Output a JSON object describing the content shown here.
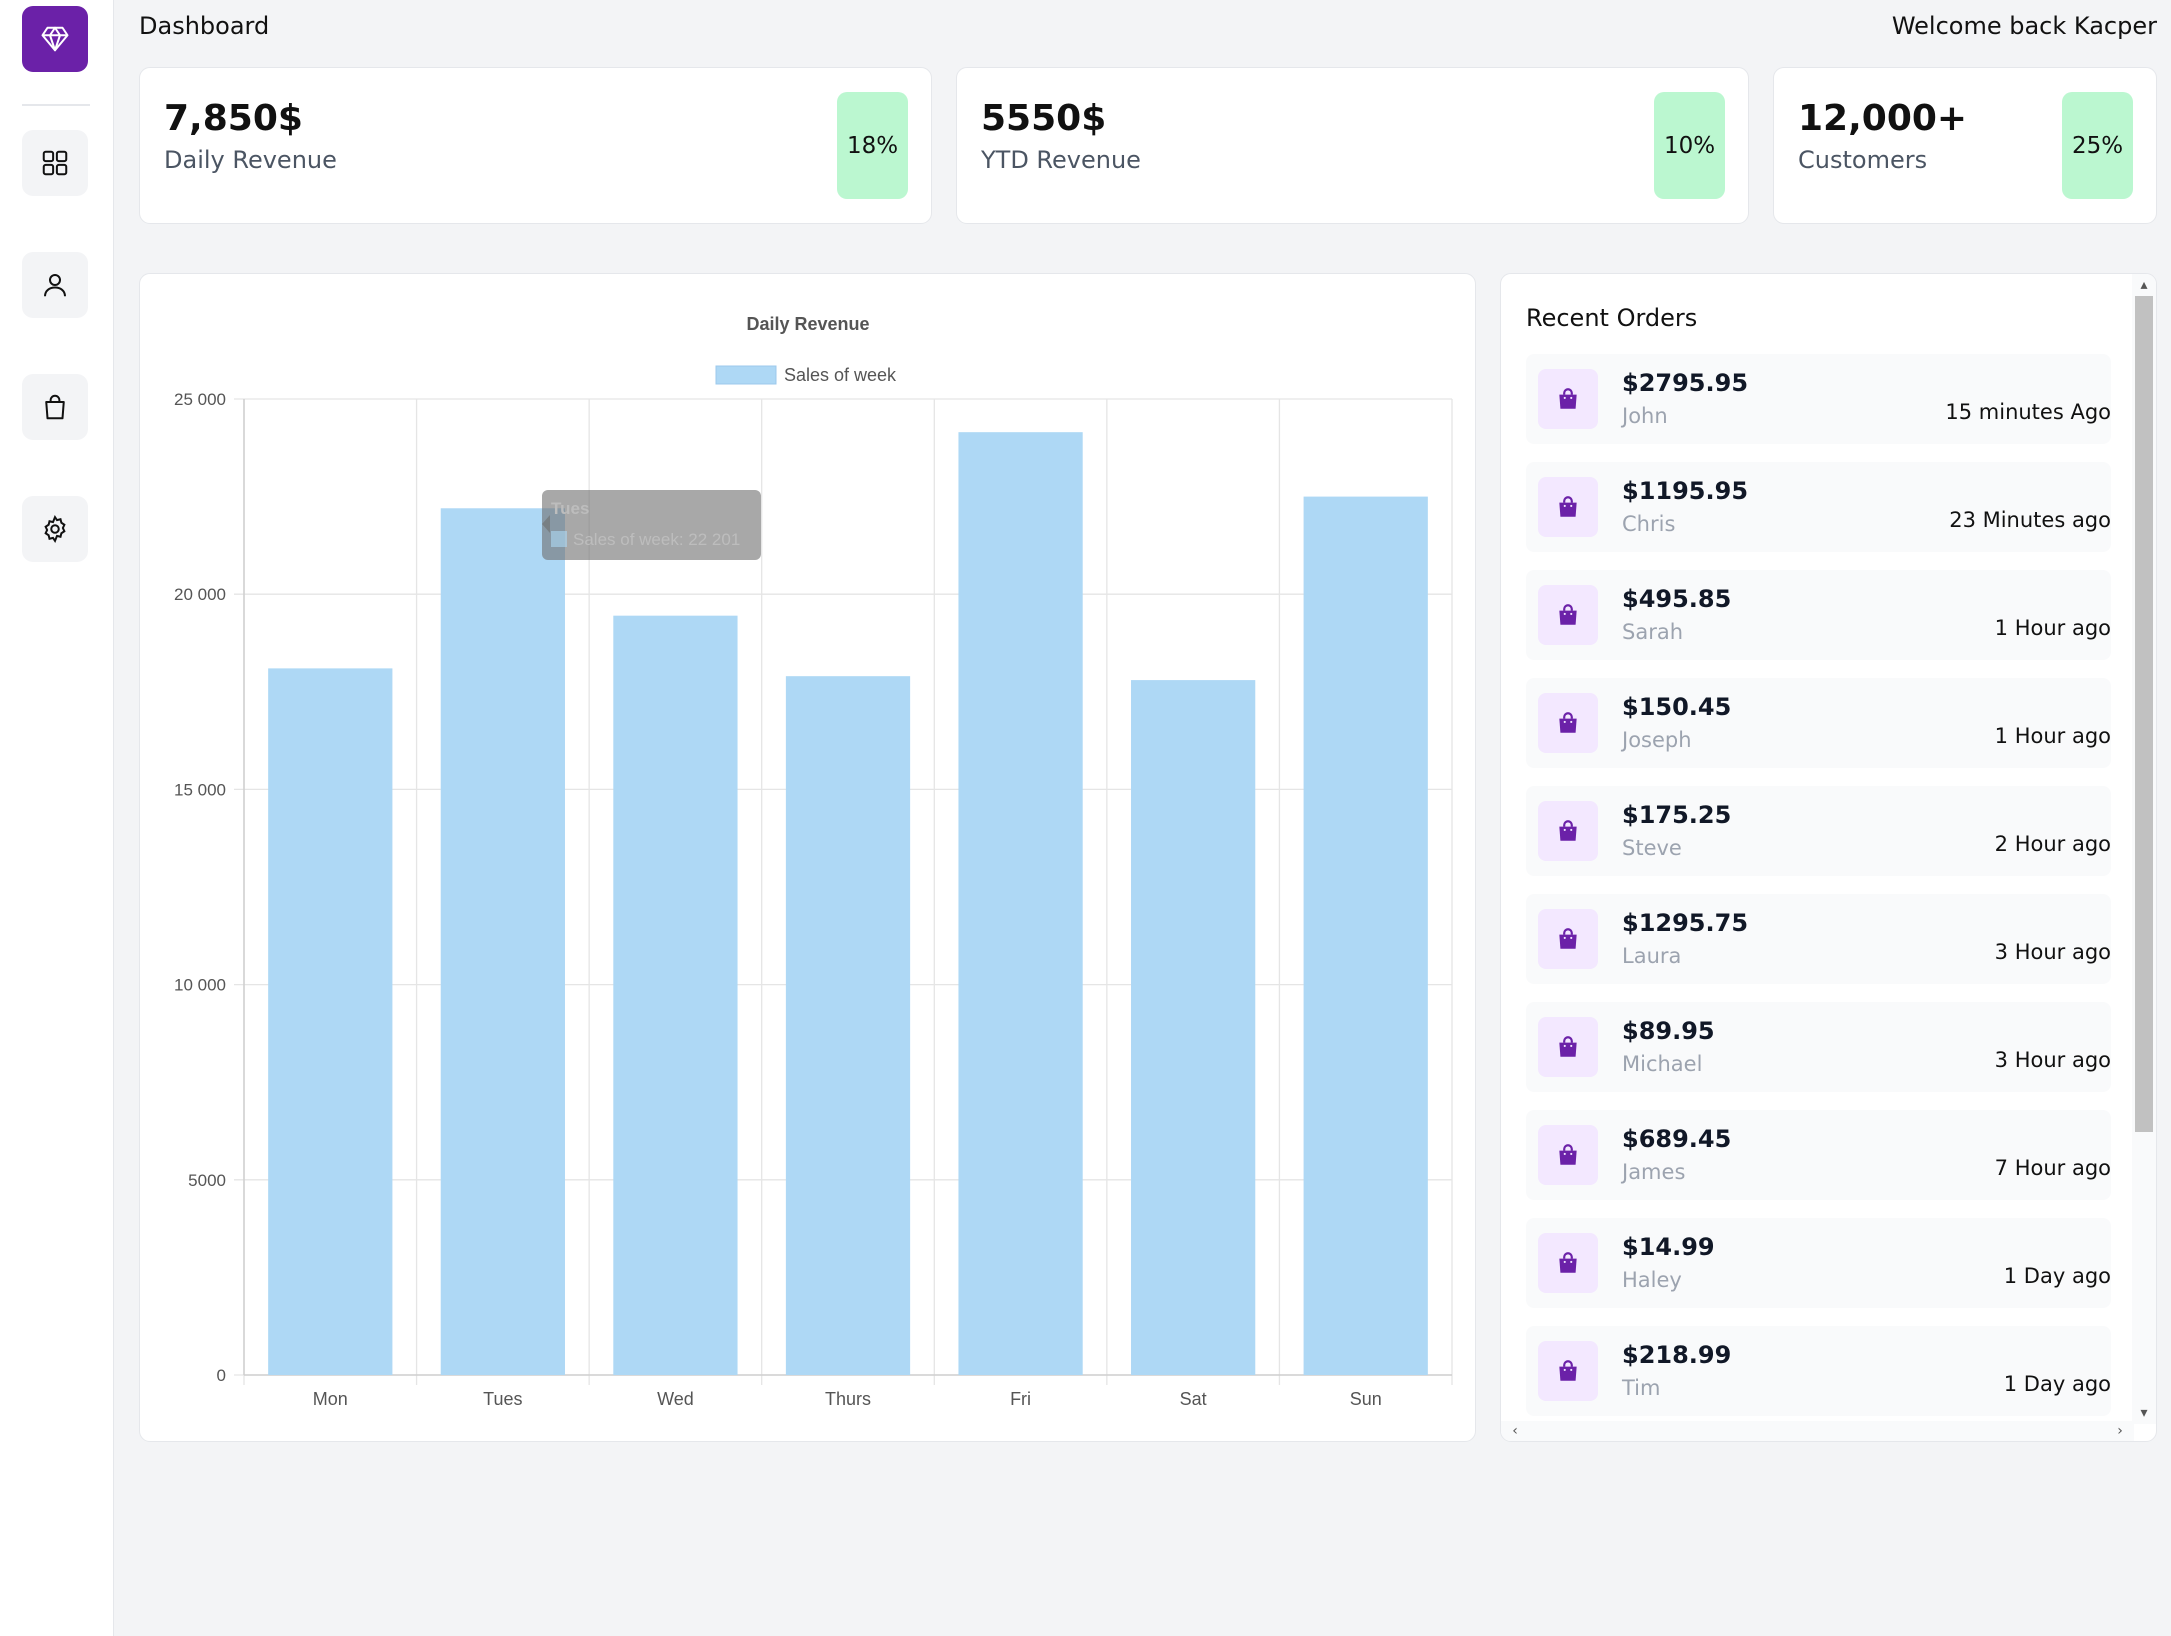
{
  "sidebar": {
    "logo_icon": "diamond-icon",
    "items": [
      {
        "icon": "dashboard-grid-icon"
      },
      {
        "icon": "user-icon"
      },
      {
        "icon": "shopping-bag-icon"
      },
      {
        "icon": "settings-gear-icon"
      }
    ]
  },
  "header": {
    "title": "Dashboard",
    "welcome": "Welcome back Kacper"
  },
  "stats": [
    {
      "value": "7,850$",
      "label": "Daily Revenue",
      "badge": "18%"
    },
    {
      "value": "5550$",
      "label": "YTD Revenue",
      "badge": "10%"
    },
    {
      "value": "12,000+",
      "label": "Customers",
      "badge": "25%"
    }
  ],
  "chart_data": {
    "type": "bar",
    "title": "Daily Revenue",
    "legend": "Sales of week",
    "legend_position": "top",
    "categories": [
      "Mon",
      "Tues",
      "Wed",
      "Thurs",
      "Fri",
      "Sat",
      "Sun"
    ],
    "series": [
      {
        "name": "Sales of week",
        "values": [
          18100,
          22201,
          19450,
          17900,
          24150,
          17800,
          22500
        ]
      }
    ],
    "ylim": [
      0,
      25000
    ],
    "yticks": [
      "0",
      "5000",
      "10 000",
      "15 000",
      "20 000",
      "25 000"
    ],
    "grid": true,
    "bar_color": "#aed8f5",
    "tooltip": {
      "title": "Tues",
      "text": "Sales of week: 22 201"
    }
  },
  "orders": {
    "title": "Recent Orders",
    "items": [
      {
        "amount": "$2795.95",
        "name": "John",
        "time": "15 minutes Ago"
      },
      {
        "amount": "$1195.95",
        "name": "Chris",
        "time": "23 Minutes ago"
      },
      {
        "amount": "$495.85",
        "name": "Sarah",
        "time": "1 Hour ago"
      },
      {
        "amount": "$150.45",
        "name": "Joseph",
        "time": "1 Hour ago"
      },
      {
        "amount": "$175.25",
        "name": "Steve",
        "time": "2 Hour ago"
      },
      {
        "amount": "$1295.75",
        "name": "Laura",
        "time": "3 Hour ago"
      },
      {
        "amount": "$89.95",
        "name": "Michael",
        "time": "3 Hour ago"
      },
      {
        "amount": "$689.45",
        "name": "James",
        "time": "7 Hour ago"
      },
      {
        "amount": "$14.99",
        "name": "Haley",
        "time": "1 Day ago"
      },
      {
        "amount": "$218.99",
        "name": "Tim",
        "time": "1 Day ago"
      }
    ]
  },
  "colors": {
    "accent": "#6b21a8",
    "badge_bg": "#bbf7d0",
    "order_icon_bg": "#f3e8ff"
  }
}
